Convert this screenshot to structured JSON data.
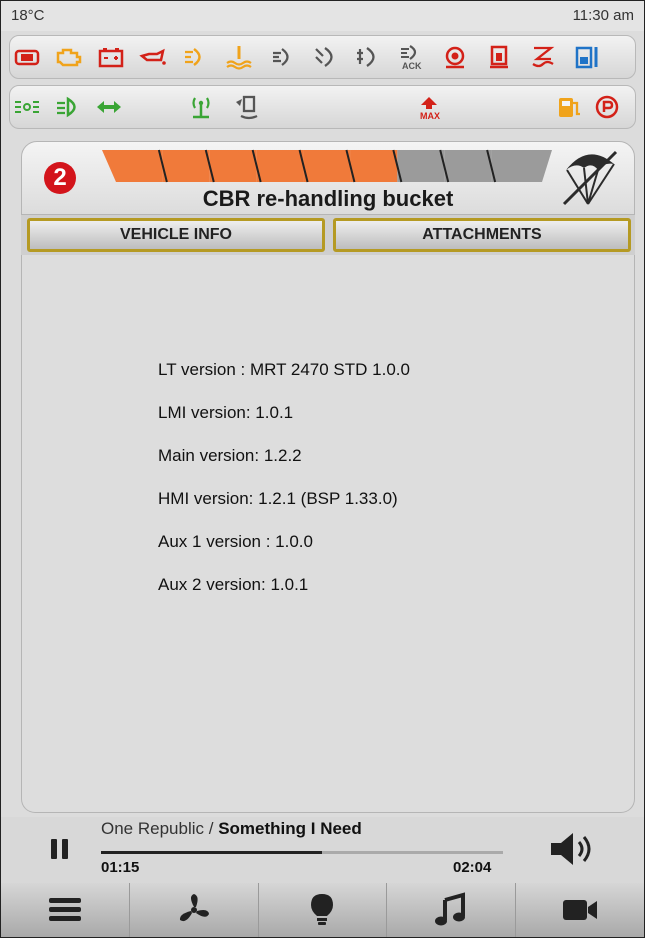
{
  "status": {
    "temperature": "18°C",
    "time": "11:30 am"
  },
  "warnings_row1": [
    {
      "name": "stop-engine-icon",
      "color": "#d32118"
    },
    {
      "name": "engine-check-icon",
      "color": "#f0a31b"
    },
    {
      "name": "battery-icon",
      "color": "#d32118"
    },
    {
      "name": "oil-pressure-icon",
      "color": "#d32118"
    },
    {
      "name": "hydraulic-filter-icon",
      "color": "#f0a31b"
    },
    {
      "name": "coolant-temperature-icon",
      "color": "#f0a31b"
    },
    {
      "name": "transmission-temperature-icon",
      "color": "#555555"
    },
    {
      "name": "transmission-pressure-icon",
      "color": "#555555"
    },
    {
      "name": "hydraulic-pressure-icon",
      "color": "#555555"
    },
    {
      "name": "lmi-acknowledge-icon",
      "color": "#555555",
      "label": "ACK"
    },
    {
      "name": "brake-warning-icon",
      "color": "#d32118"
    },
    {
      "name": "seat-belt-icon",
      "color": "#d32118"
    },
    {
      "name": "stabilizer-icon",
      "color": "#d32118"
    },
    {
      "name": "hydraulic-oil-level-icon",
      "color": "#1f73c7"
    }
  ],
  "warnings_row2": [
    {
      "name": "position-lights-icon",
      "color": "#3aa535"
    },
    {
      "name": "low-beam-icon",
      "color": "#3aa535"
    },
    {
      "name": "turn-signals-icon",
      "color": "#3aa535"
    },
    {
      "name": "radio-remote-icon",
      "color": "#3aa535"
    },
    {
      "name": "boom-leveling-icon",
      "color": "#555555"
    },
    {
      "name": "max-load-icon",
      "color": "#d32118",
      "label": "MAX"
    },
    {
      "name": "fuel-level-icon",
      "color": "#f0a31b"
    },
    {
      "name": "parking-brake-icon",
      "color": "#d32118"
    }
  ],
  "tool": {
    "number": "2",
    "name": "CBR re-handling bucket",
    "level_segments_total": 9,
    "level_segments_filled": 6,
    "colors": {
      "filled": "#f07a3a",
      "empty": "#9b9b9b",
      "badge": "#d3141b"
    }
  },
  "tabs": {
    "vehicle_info": "VEHICLE INFO",
    "attachments": "ATTACHMENTS"
  },
  "versions": [
    "LT version : MRT 2470 STD 1.0.0",
    "LMI version: 1.0.1",
    "Main version: 1.2.2",
    "HMI version: 1.2.1 (BSP 1.33.0)",
    "Aux 1 version : 1.0.0",
    "Aux 2 version: 1.0.1"
  ],
  "media": {
    "artist": "One Republic",
    "separator": " / ",
    "song": "Something I Need",
    "elapsed": "01:15",
    "duration": "02:04",
    "progress_fraction": 0.55
  },
  "bottom_nav": [
    {
      "name": "menu-icon"
    },
    {
      "name": "fan-icon"
    },
    {
      "name": "light-bulb-icon"
    },
    {
      "name": "music-note-icon"
    },
    {
      "name": "video-camera-icon"
    }
  ]
}
